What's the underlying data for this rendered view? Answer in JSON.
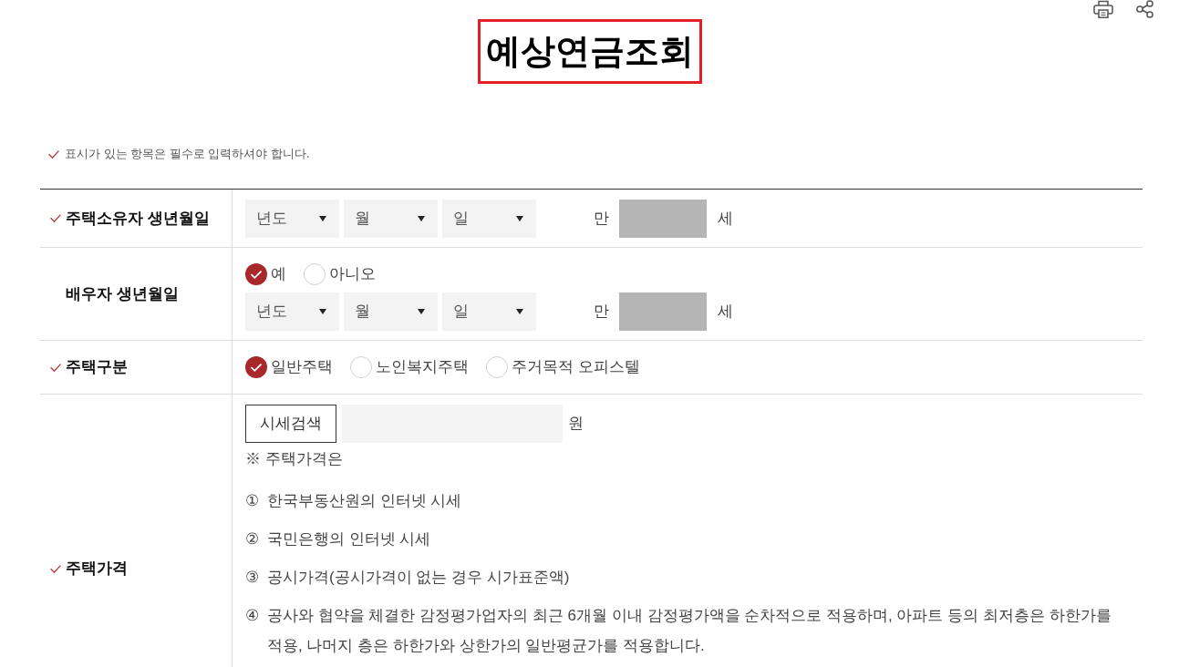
{
  "page": {
    "title": "예상연금조회"
  },
  "required_note": "표시가 있는 항목은 필수로 입력하셔야 합니다.",
  "form": {
    "rows": [
      {
        "kind": "birthdate",
        "label": "주택소유자 생년월일",
        "required": true,
        "selects": [
          "년도",
          "월",
          "일"
        ],
        "age_prefix": "만",
        "age_unit": "세"
      },
      {
        "kind": "spouse_birthdate",
        "label": "배우자 생년월일",
        "required": false,
        "options": [
          {
            "label": "예",
            "selected": true
          },
          {
            "label": "아니오",
            "selected": false
          }
        ],
        "selects": [
          "년도",
          "월",
          "일"
        ],
        "age_prefix": "만",
        "age_unit": "세"
      },
      {
        "kind": "choice",
        "label": "주택구분",
        "required": true,
        "options": [
          {
            "label": "일반주택",
            "selected": true
          },
          {
            "label": "노인복지주택",
            "selected": false
          },
          {
            "label": "주거목적 오피스텔",
            "selected": false
          }
        ]
      },
      {
        "kind": "price",
        "label": "주택가격",
        "required": true,
        "button": "시세검색",
        "unit": "원",
        "note": "※ 주택가격은",
        "items": [
          {
            "marker": "①",
            "text": "한국부동산원의 인터넷 시세"
          },
          {
            "marker": "②",
            "text": "국민은행의 인터넷 시세"
          },
          {
            "marker": "③",
            "text": "공시가격(공시가격이 없는 경우 시가표준액)"
          },
          {
            "marker": "④",
            "text": "공사와 협약을 체결한 감정평가업자의 최근 6개월 이내 감정평가액을 순차적으로 적용하며, 아파트 등의 최저층은 하한가를 적용, 나머지 층은 하한가와 상한가의 일반평균가를 적용합니다."
          }
        ]
      }
    ]
  }
}
